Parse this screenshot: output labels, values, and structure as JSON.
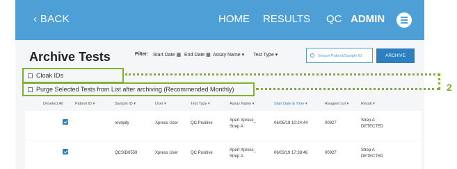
{
  "nav": {
    "back": "‹ BACK",
    "home": "HOME",
    "results": "RESULTS",
    "qc": "QC",
    "admin": "ADMIN",
    "menu_icon": "menu-icon"
  },
  "page": {
    "title": "Archive Tests"
  },
  "filters": {
    "label": "Filter:",
    "start_date": "Start Date",
    "end_date": "End Date",
    "assay_name": "Assay Name",
    "test_type": "Test Type",
    "calendar_icon": "calendar-icon",
    "dropdown_icon": "chevron-down-icon",
    "search_placeholder": "Search Patient/Sample ID",
    "archive_button": "ARCHIVE"
  },
  "options": {
    "cloak_ids": "Cloak IDs",
    "purge": "Purge Selected Tests from List after archiving (Recommended Monthly)"
  },
  "table": {
    "headers": {
      "deselect": "Deselect All",
      "patient_id": "Patient ID",
      "sample_id": "Sample ID",
      "user": "User",
      "test_type": "Test Type",
      "assay_name": "Assay Name",
      "start_date_time": "Start Date & Time",
      "reagent_lot": "Reagent Lot",
      "result": "Result"
    },
    "rows": [
      {
        "checked": true,
        "patient_id": "",
        "sample_id": "revitpity",
        "user": "Xpress User",
        "test_type": "QC Positive",
        "assay_line1": "Xpert Xpress_",
        "assay_line2": "Strep A",
        "start": "06/05/19 10:24:44",
        "reagent_lot": "00927",
        "result_line1": "Strep A",
        "result_line2": "DETECTED"
      },
      {
        "checked": true,
        "patient_id": "",
        "sample_id": "QCSID0559",
        "user": "Xpress User",
        "test_type": "QC Positive",
        "assay_line1": "Xpert Xpress_",
        "assay_line2": "Strep A",
        "start": "06/03/19 17:38:46",
        "reagent_lot": "00927",
        "result_line1": "Strep A",
        "result_line2": "DETECTED"
      }
    ]
  },
  "callout": {
    "number": "2"
  },
  "colors": {
    "nav_blue": "#4d9fd6",
    "button_blue": "#2e7fc0",
    "highlight_green": "#80b030"
  }
}
